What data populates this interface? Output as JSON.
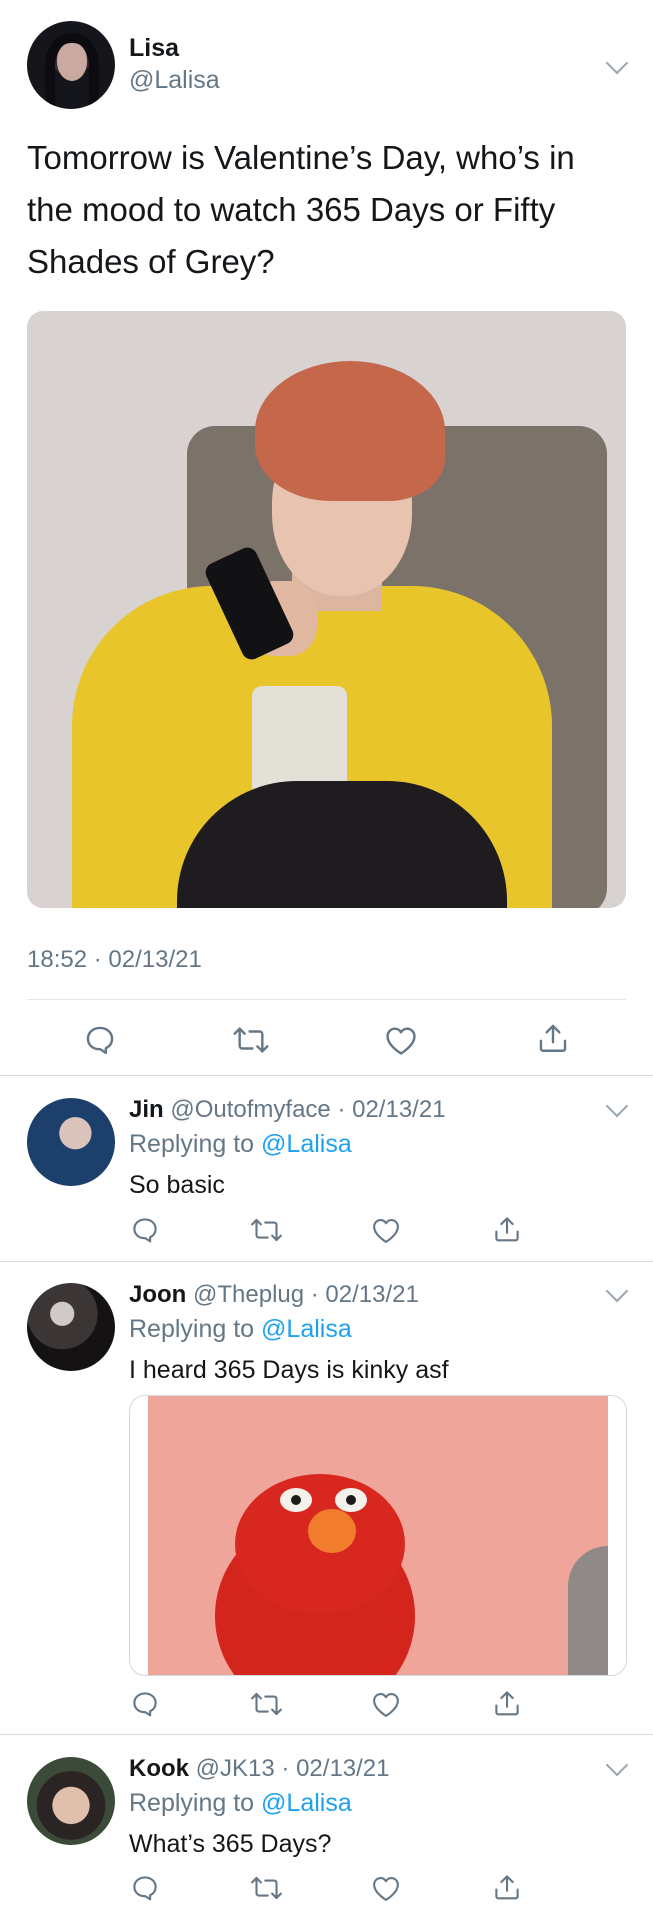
{
  "colors": {
    "text": "#14171a",
    "muted": "#657786",
    "link": "#1da1f2",
    "divider": "#e1e8ed"
  },
  "main_tweet": {
    "name": "Lisa",
    "handle": "@Lalisa",
    "text": "Tomorrow is Valentine’s Day, who’s in the mood to watch 365 Days or Fifty Shades of Grey?",
    "timestamp": "18:52 · 02/13/21",
    "actions": [
      "reply-icon",
      "retweet-icon",
      "like-icon",
      "share-icon"
    ]
  },
  "replies": [
    {
      "name": "Jin",
      "handle": "@Outofmyface",
      "date": "· 02/13/21",
      "replying_label": "Replying to",
      "replying_to": "@Lalisa",
      "text": "So basic"
    },
    {
      "name": "Joon",
      "handle": "@Theplug",
      "date": "· 02/13/21",
      "replying_label": "Replying to",
      "replying_to": "@Lalisa",
      "text": "I heard 365 Days is kinky asf"
    },
    {
      "name": "Kook",
      "handle": "@JK13",
      "date": "· 02/13/21",
      "replying_label": "Replying to",
      "replying_to": "@Lalisa",
      "text": "What’s 365 Days?"
    }
  ]
}
